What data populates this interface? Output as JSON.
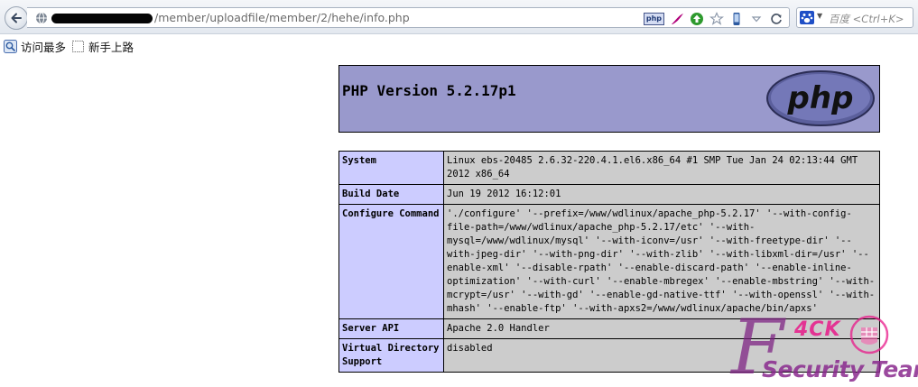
{
  "browser": {
    "url_text": "/member/uploadfile/member/2/hehe/info.php",
    "search_placeholder": "百度 <Ctrl+K>",
    "php_badge": "php",
    "bookmarks": [
      {
        "label": "访问最多"
      },
      {
        "label": "新手上路"
      }
    ]
  },
  "page": {
    "title": "PHP Version 5.2.17p1",
    "logo_text": "php",
    "rows": [
      {
        "key": "System",
        "value": "Linux ebs-20485 2.6.32-220.4.1.el6.x86_64 #1 SMP Tue Jan 24 02:13:44 GMT 2012 x86_64"
      },
      {
        "key": "Build Date",
        "value": "Jun 19 2012 16:12:01"
      },
      {
        "key": "Configure Command",
        "value": "'./configure' '--prefix=/www/wdlinux/apache_php-5.2.17' '--with-config-file-path=/www/wdlinux/apache_php-5.2.17/etc' '--with-mysql=/www/wdlinux/mysql' '--with-iconv=/usr' '--with-freetype-dir' '--with-jpeg-dir' '--with-png-dir' '--with-zlib' '--with-libxml-dir=/usr' '--enable-xml' '--disable-rpath' '--enable-discard-path' '--enable-inline-optimization' '--with-curl' '--enable-mbregex' '--enable-mbstring' '--with-mcrypt=/usr' '--with-gd' '--enable-gd-native-ttf' '--with-openssl' '--with-mhash' '--enable-ftp' '--with-apxs2=/www/wdlinux/apache/bin/apxs'"
      },
      {
        "key": "Server API",
        "value": "Apache 2.0 Handler"
      },
      {
        "key": "Virtual Directory Support",
        "value": "disabled"
      }
    ]
  },
  "watermark": {
    "letter": "F",
    "top_text": "4CK",
    "bottom_text": "Security Team"
  },
  "colors": {
    "header_bg": "#9999cc",
    "key_bg": "#ccccff",
    "value_bg": "#cccccc",
    "watermark_purple": "#7c1f82",
    "watermark_pink": "#e81a8a"
  }
}
